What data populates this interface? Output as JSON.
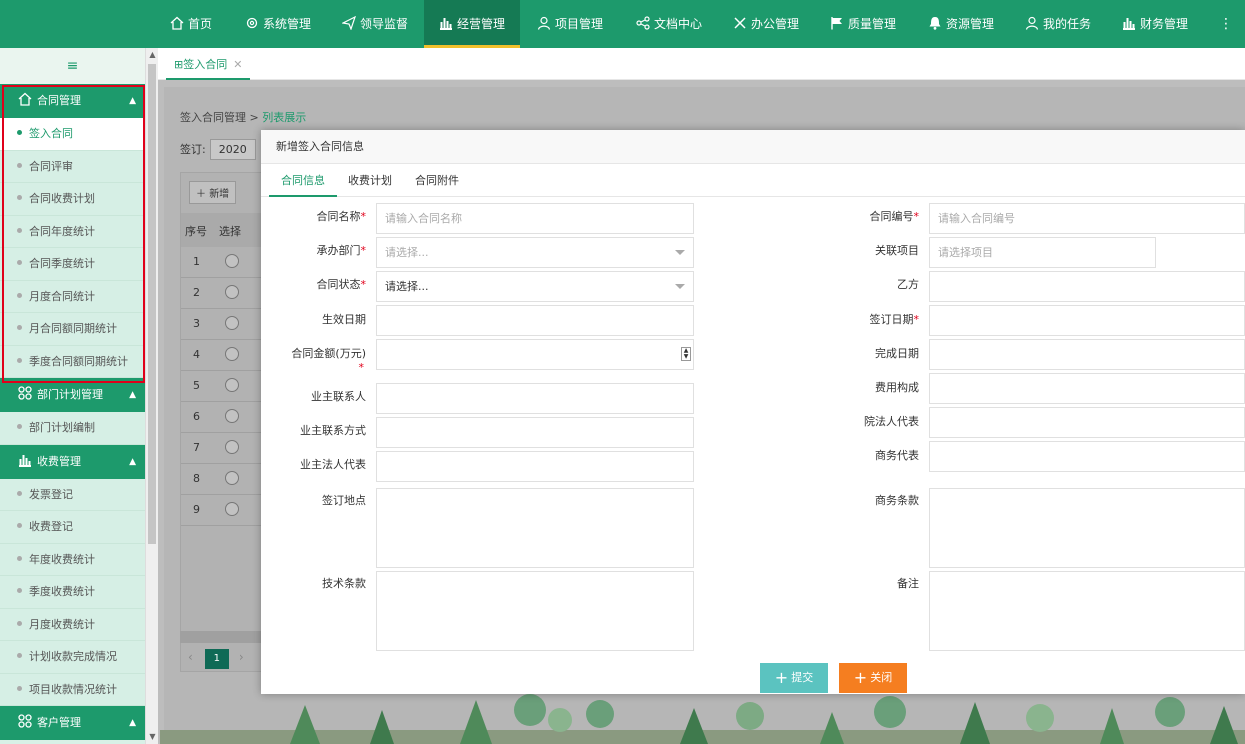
{
  "topnav": {
    "items": [
      {
        "label": "首页",
        "icon": "home-icon"
      },
      {
        "label": "系统管理",
        "icon": "gear-icon"
      },
      {
        "label": "领导监督",
        "icon": "paper-plane-icon"
      },
      {
        "label": "经营管理",
        "icon": "bar-chart-icon",
        "active": true
      },
      {
        "label": "项目管理",
        "icon": "user-icon"
      },
      {
        "label": "文档中心",
        "icon": "share-icon"
      },
      {
        "label": "办公管理",
        "icon": "tools-icon"
      },
      {
        "label": "质量管理",
        "icon": "flag-icon"
      },
      {
        "label": "资源管理",
        "icon": "bell-icon"
      },
      {
        "label": "我的任务",
        "icon": "user-icon"
      },
      {
        "label": "财务管理",
        "icon": "bar-chart-icon"
      }
    ],
    "more": "⋮"
  },
  "sidebar": {
    "toggle": "≡",
    "groups": [
      {
        "title": "合同管理",
        "icon": "home-icon",
        "items": [
          "签入合同",
          "合同评审",
          "合同收费计划",
          "合同年度统计",
          "合同季度统计",
          "月度合同统计",
          "月合同额同期统计",
          "季度合同额同期统计"
        ]
      },
      {
        "title": "部门计划管理",
        "icon": "grid-icon",
        "items": [
          "部门计划编制"
        ]
      },
      {
        "title": "收费管理",
        "icon": "bar-chart-icon",
        "items": [
          "发票登记",
          "收费登记",
          "年度收费统计",
          "季度收费统计",
          "月度收费统计",
          "计划收款完成情况",
          "项目收款情况统计"
        ]
      },
      {
        "title": "客户管理",
        "icon": "grid-icon",
        "items": []
      }
    ]
  },
  "tabs": [
    {
      "label": "签入合同",
      "icon": "grid-icon"
    }
  ],
  "page": {
    "breadcrumb_root": "签入合同管理",
    "breadcrumb_sep": ">",
    "breadcrumb_current": "列表展示",
    "filter_label": "签订:",
    "filter_year": "2020",
    "add_label": "新增",
    "columns": [
      "序号",
      "选择"
    ],
    "rows": [
      "1",
      "2",
      "3",
      "4",
      "5",
      "6",
      "7",
      "8",
      "9"
    ],
    "page_number": "1"
  },
  "modal": {
    "title": "新增签入合同信息",
    "tabs": [
      "合同信息",
      "收费计划",
      "合同附件"
    ],
    "left_fields": {
      "name_label": "合同名称",
      "name_placeholder": "请输入合同名称",
      "dept_label": "承办部门",
      "dept_value": "请选择...",
      "status_label": "合同状态",
      "status_value": "请选择...",
      "effective_label": "生效日期",
      "amount_label": "合同金额(万元)",
      "owner_contact_label": "业主联系人",
      "owner_phone_label": "业主联系方式",
      "owner_legal_label": "业主法人代表",
      "place_label": "签订地点",
      "tech_label": "技术条款"
    },
    "right_fields": {
      "code_label": "合同编号",
      "code_placeholder": "请输入合同编号",
      "project_label": "关联项目",
      "project_placeholder": "请选择项目",
      "partyb_label": "乙方",
      "sign_date_label": "签订日期",
      "finish_date_label": "完成日期",
      "cost_label": "费用构成",
      "legal_rep_label": "院法人代表",
      "biz_rep_label": "商务代表",
      "biz_terms_label": "商务条款",
      "remark_label": "备注"
    },
    "required_mark": "*",
    "submit_label": "提交",
    "close_label": "关闭"
  },
  "colors": {
    "primary": "#1d9a6c",
    "submit": "#5bc3c0",
    "close": "#f57e20",
    "highlight_box": "#e0001a"
  }
}
